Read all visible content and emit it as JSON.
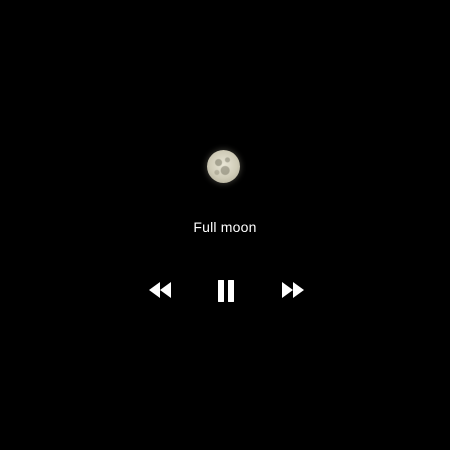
{
  "track": {
    "title": "Full moon"
  },
  "controls": {
    "rewind_icon": "rewind-icon",
    "pause_icon": "pause-icon",
    "forward_icon": "fast-forward-icon"
  },
  "colors": {
    "background": "#000000",
    "text": "#ffffff",
    "icons": "#ffffff"
  }
}
